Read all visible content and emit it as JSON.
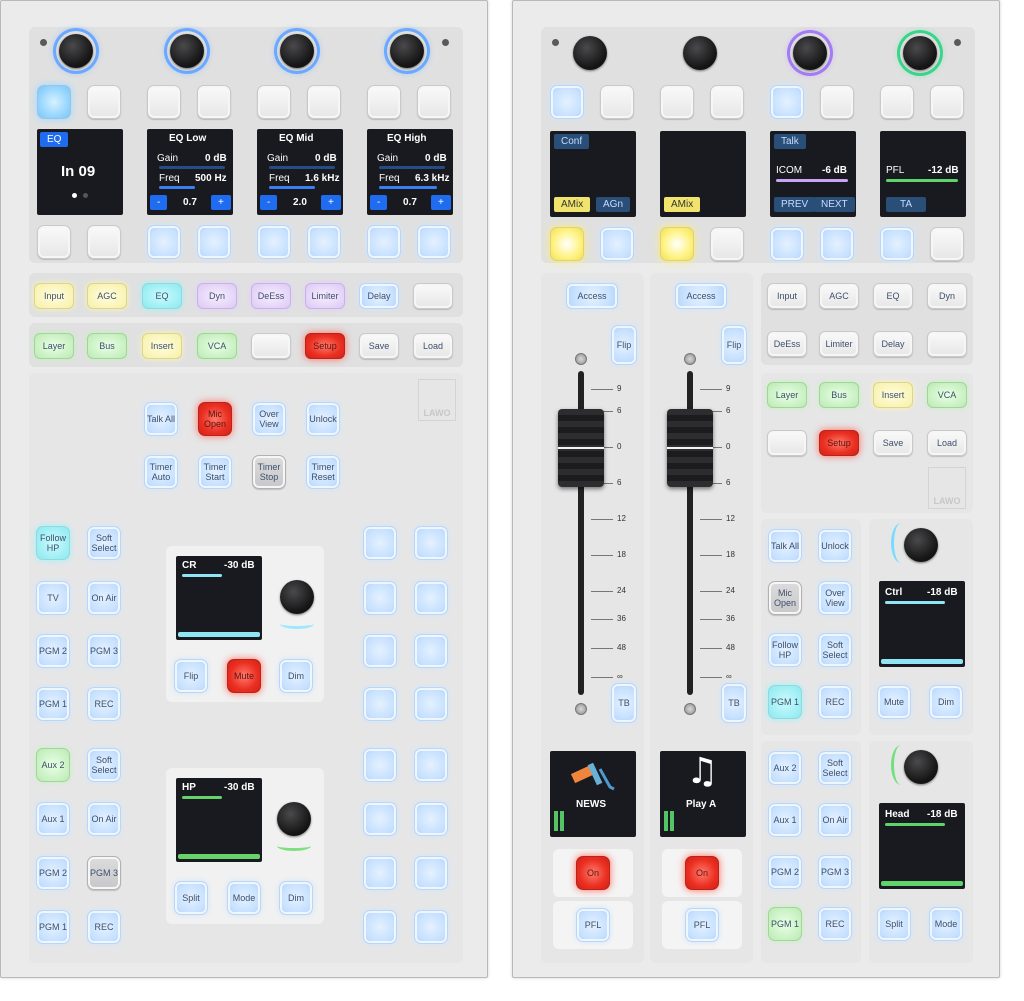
{
  "left": {
    "channels": [
      {
        "screen_tag": "EQ",
        "main": "In 09"
      },
      {
        "title": "EQ Low",
        "gain_label": "Gain",
        "gain": "0 dB",
        "freq_label": "Freq",
        "freq": "500 Hz",
        "minus": "-",
        "value": "0.7",
        "plus": "+"
      },
      {
        "title": "EQ Mid",
        "gain_label": "Gain",
        "gain": "0 dB",
        "freq_label": "Freq",
        "freq": "1.6 kHz",
        "minus": "-",
        "value": "2.0",
        "plus": "+"
      },
      {
        "title": "EQ High",
        "gain_label": "Gain",
        "gain": "0 dB",
        "freq_label": "Freq",
        "freq": "6.3 kHz",
        "minus": "-",
        "value": "0.7",
        "plus": "+"
      }
    ],
    "row1": [
      "Input",
      "AGC",
      "EQ",
      "Dyn",
      "DeEss",
      "Limiter",
      "Delay",
      ""
    ],
    "row2": [
      "Layer",
      "Bus",
      "Insert",
      "VCA",
      "",
      "Setup",
      "Save",
      "Load"
    ],
    "logo": "LAWO",
    "center_buttons": [
      "Talk All",
      "Mic Open",
      "Over View",
      "Unlock",
      "Timer Auto",
      "Timer Start",
      "Timer Stop",
      "Timer Reset"
    ],
    "left_col_top": [
      "Follow HP",
      "Soft Select",
      "TV",
      "On Air",
      "PGM 2",
      "PGM 3",
      "PGM 1",
      "REC"
    ],
    "left_col_bottom": [
      "Aux 2",
      "Soft Select",
      "Aux 1",
      "On Air",
      "PGM 2",
      "PGM 3",
      "PGM 1",
      "REC"
    ],
    "cr": {
      "label": "CR",
      "level": "-30 dB",
      "buttons": [
        "Flip",
        "Mute",
        "Dim"
      ]
    },
    "hp": {
      "label": "HP",
      "level": "-30 dB",
      "buttons": [
        "Split",
        "Mode",
        "Dim"
      ]
    }
  },
  "right": {
    "screens": [
      {
        "tag": "Conf",
        "bottom": [
          "AMix",
          "AGn"
        ]
      },
      {
        "bottom": [
          "AMix"
        ]
      },
      {
        "tag": "Talk",
        "label": "ICOM",
        "level": "-6 dB",
        "bottom": [
          "PREV",
          "NEXT"
        ]
      },
      {
        "label": "PFL",
        "level": "-12 dB",
        "bottom": [
          "TA"
        ]
      }
    ],
    "access": "Access",
    "flip": "Flip",
    "tb": "TB",
    "scale": [
      "9",
      "6",
      "0",
      "6",
      "12",
      "18",
      "24",
      "36",
      "48",
      "∞"
    ],
    "sources": [
      "NEWS",
      "Play A"
    ],
    "on": "On",
    "pfl": "PFL",
    "row1": [
      "Input",
      "AGC",
      "EQ",
      "Dyn"
    ],
    "row2": [
      "DeEss",
      "Limiter",
      "Delay",
      ""
    ],
    "row3": [
      "Layer",
      "Bus",
      "Insert",
      "VCA"
    ],
    "row4": [
      "",
      "Setup",
      "Save",
      "Load"
    ],
    "logo": "LAWO",
    "grid_top": [
      "Talk All",
      "Unlock",
      "Mic Open",
      "Over View",
      "Follow HP",
      "Soft Select",
      "PGM 1",
      "REC"
    ],
    "grid_bottom": [
      "Aux 2",
      "Soft Select",
      "Aux 1",
      "On Air",
      "PGM 2",
      "PGM 3",
      "PGM 1",
      "REC"
    ],
    "ctrl": {
      "label": "Ctrl",
      "level": "-18 dB",
      "buttons": [
        "Mute",
        "Dim"
      ]
    },
    "head": {
      "label": "Head",
      "level": "-18 dB",
      "buttons": [
        "Split",
        "Mode"
      ]
    }
  }
}
